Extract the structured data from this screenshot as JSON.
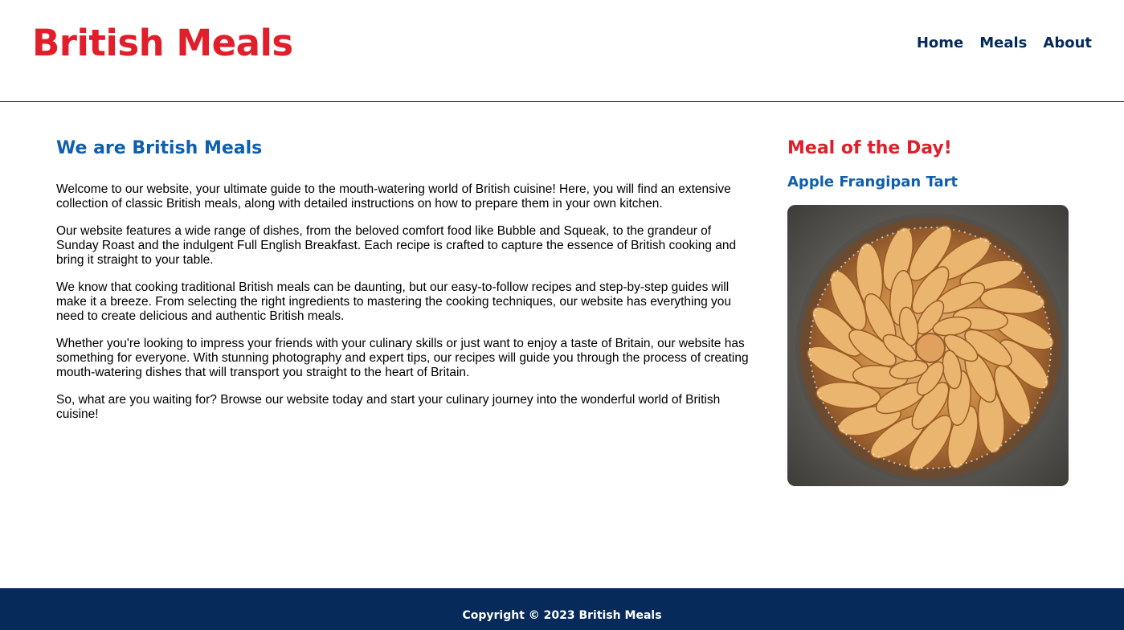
{
  "header": {
    "logo": "British Meals",
    "nav": [
      {
        "label": "Home"
      },
      {
        "label": "Meals"
      },
      {
        "label": "About"
      }
    ]
  },
  "main": {
    "title": "We are British Meals",
    "paragraphs": [
      "Welcome to our website, your ultimate guide to the mouth-watering world of British cuisine! Here, you will find an extensive collection of classic British meals, along with detailed instructions on how to prepare them in your own kitchen.",
      "Our website features a wide range of dishes, from the beloved comfort food like Bubble and Squeak, to the grandeur of Sunday Roast and the indulgent Full English Breakfast. Each recipe is crafted to capture the essence of British cooking and bring it straight to your table.",
      "We know that cooking traditional British meals can be daunting, but our easy-to-follow recipes and step-by-step guides will make it a breeze. From selecting the right ingredients to mastering the cooking techniques, our website has everything you need to create delicious and authentic British meals.",
      "Whether you're looking to impress your friends with your culinary skills or just want to enjoy a taste of Britain, our website has something for everyone. With stunning photography and expert tips, our recipes will guide you through the process of creating mouth-watering dishes that will transport you straight to the heart of Britain.",
      "So, what are you waiting for? Browse our website today and start your culinary journey into the wonderful world of British cuisine!"
    ]
  },
  "aside": {
    "title": "Meal of the Day!",
    "meal_name": "Apple Frangipan Tart",
    "image_icon": "apple-tart-photo"
  },
  "footer": {
    "copyright": "Copyright © 2023 British Meals"
  },
  "colors": {
    "brand_red": "#e01f2b",
    "heading_blue": "#0f5fad",
    "navy": "#062a5a"
  }
}
